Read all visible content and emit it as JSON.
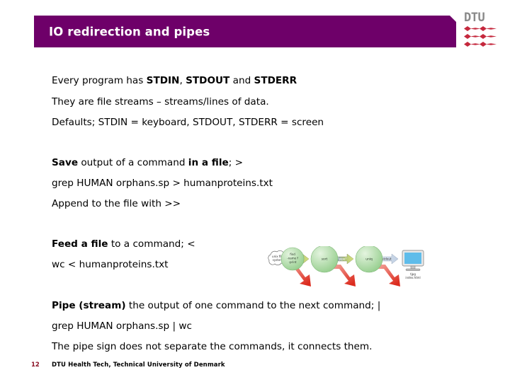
{
  "slide": {
    "title": "IO redirection and pipes",
    "accent_color": "#6E0069",
    "footer_accent_color": "#8C1226"
  },
  "logo": {
    "wordmark": "DTU",
    "bar_color": "#C5283D",
    "wordmark_color": "#8a8a8a"
  },
  "body": {
    "block1": {
      "line1_a": "Every program has ",
      "line1_b": "STDIN",
      "line1_c": ", ",
      "line1_d": "STDOUT",
      "line1_e": " and ",
      "line1_f": "STDERR",
      "line2": "They are file streams – streams/lines of data.",
      "line3": "Defaults; STDIN = keyboard, STDOUT, STDERR = screen"
    },
    "block2": {
      "line1_a": "Save",
      "line1_b": " output of a command ",
      "line1_c": "in a file",
      "line1_d": "; >",
      "line2": "grep HUMAN orphans.sp > humanproteins.txt",
      "line3": "Append to the file with >>"
    },
    "block3": {
      "line1_a": "Feed a file",
      "line1_b": " to a command; <",
      "line2": "wc < humanproteins.txt"
    },
    "block4": {
      "line1_a": "Pipe (stream)",
      "line1_b": " the output of one command to the next command; |",
      "line2": "grep HUMAN orphans.sp | wc",
      "line3": "The pipe sign does not separate the commands, it connects them."
    }
  },
  "footer": {
    "page_number": "12",
    "text": "DTU Health Tech, Technical University of Denmark"
  },
  "diagram": {
    "cloud_label_line1": "unix file",
    "cloud_label_line2": "system",
    "node1_line1": "find",
    "node1_line2": "-name f",
    "node1_line3": "-print",
    "node2": "sort",
    "node3": "uniq",
    "pipe_label1": "\"pipe\"",
    "pipe_label2": "\"pipe\"",
    "stdout_label": "stdout",
    "stderr_label1": "stderr",
    "stderr_label2": "stderr",
    "stderr_label3": "stderr",
    "monitor_label_line1": "tjpg",
    "monitor_label_line2": "index.html",
    "node_color": "#A8DCA0",
    "pipe_color": "#C9D96B",
    "stderr_color": "#E03C31",
    "stdout_color": "#C7D4E4"
  }
}
